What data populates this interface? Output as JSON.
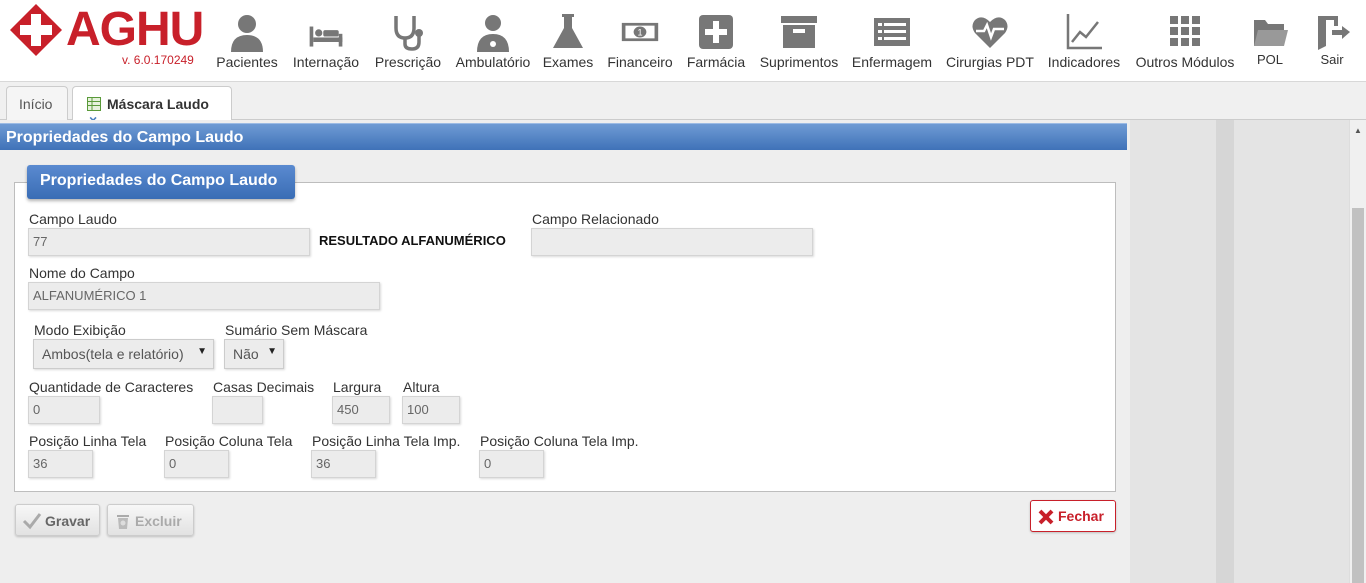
{
  "app": {
    "logo_text": "AGHU",
    "version": "v. 6.0.170249",
    "brand_color": "#c8202a"
  },
  "modules": [
    {
      "label": "Pacientes",
      "icon": "user-icon"
    },
    {
      "label": "Internação",
      "icon": "bed-icon"
    },
    {
      "label": "Prescrição",
      "icon": "stethoscope-icon"
    },
    {
      "label": "Ambulatório",
      "icon": "doctor-icon"
    },
    {
      "label": "Exames",
      "icon": "flask-icon"
    },
    {
      "label": "Financeiro",
      "icon": "money-icon"
    },
    {
      "label": "Farmácia",
      "icon": "plus-box-icon"
    },
    {
      "label": "Suprimentos",
      "icon": "box-icon"
    },
    {
      "label": "Enfermagem",
      "icon": "list-icon"
    },
    {
      "label": "Cirurgias PDT",
      "icon": "heart-pulse-icon"
    },
    {
      "label": "Indicadores",
      "icon": "line-chart-icon"
    },
    {
      "label": "Outros Módulos",
      "icon": "grid-icon"
    },
    {
      "label": "POL",
      "icon": "folder-icon"
    },
    {
      "label": "Sair",
      "icon": "exit-icon"
    }
  ],
  "tabs": {
    "home": "Início",
    "active": "Máscara Laudo",
    "close": "×"
  },
  "panel": {
    "header": "Propriedades do Campo Laudo",
    "legend": "Propriedades do Campo Laudo"
  },
  "form": {
    "campo_laudo": {
      "label": "Campo Laudo",
      "value": "77"
    },
    "resultado": "RESULTADO ALFANUMÉRICO",
    "campo_relacionado": {
      "label": "Campo Relacionado",
      "value": ""
    },
    "nome_campo": {
      "label": "Nome do Campo",
      "value": "ALFANUMÉRICO 1"
    },
    "modo_exibicao": {
      "label": "Modo Exibição",
      "value": "Ambos(tela e relatório)"
    },
    "sumario": {
      "label": "Sumário Sem Máscara",
      "value": "Não"
    },
    "qtd_caracteres": {
      "label": "Quantidade de Caracteres",
      "value": "0"
    },
    "casas_decimais": {
      "label": "Casas Decimais",
      "value": ""
    },
    "largura": {
      "label": "Largura",
      "value": "450"
    },
    "altura": {
      "label": "Altura",
      "value": "100"
    },
    "pos_linha_tela": {
      "label": "Posição Linha Tela",
      "value": "36"
    },
    "pos_coluna_tela": {
      "label": "Posição Coluna Tela",
      "value": "0"
    },
    "pos_linha_imp": {
      "label": "Posição Linha Tela Imp.",
      "value": "36"
    },
    "pos_coluna_imp": {
      "label": "Posição Coluna Tela Imp.",
      "value": "0"
    }
  },
  "buttons": {
    "gravar": "Gravar",
    "excluir": "Excluir",
    "fechar": "Fechar"
  }
}
